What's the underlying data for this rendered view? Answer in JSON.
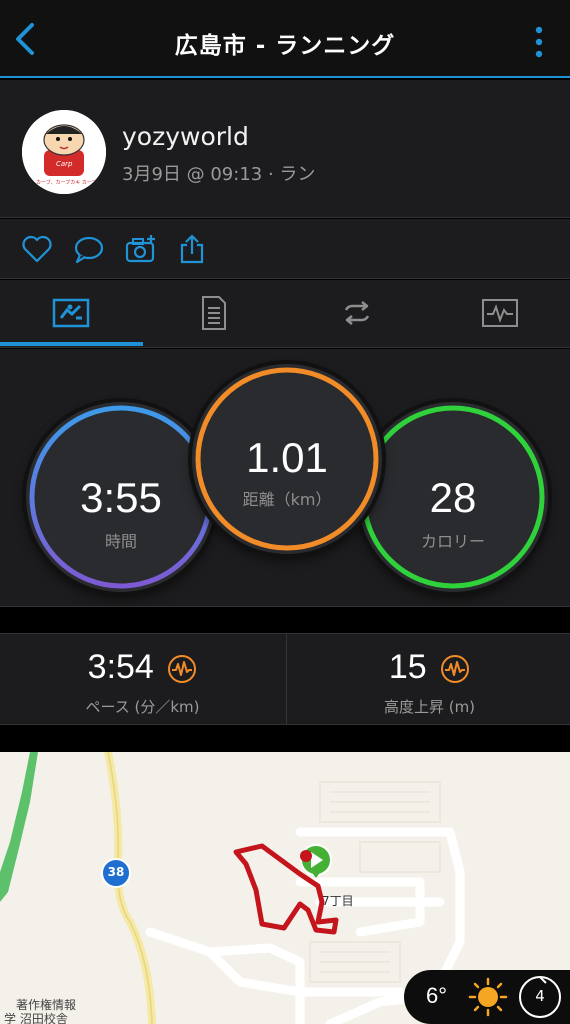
{
  "header": {
    "title": "広島市 - ランニング"
  },
  "profile": {
    "username": "yozyworld",
    "subline": "3月9日 @ 09:13 · ラン",
    "avatar_caption": "カーブ、カーブカキ カーブ!"
  },
  "tabs": [
    "overview",
    "details",
    "laps",
    "charts"
  ],
  "summary": {
    "time": {
      "value": "3:55",
      "label": "時間"
    },
    "distance": {
      "value": "1.01",
      "label": "距離（km）"
    },
    "calories": {
      "value": "28",
      "label": "カロリー"
    }
  },
  "stats": {
    "pace": {
      "value": "3:54",
      "label": "ペース (分／km)"
    },
    "elevation": {
      "value": "15",
      "label": "高度上昇 (m)"
    }
  },
  "map": {
    "route_badge": "38",
    "area_label": "7丁目",
    "poi_label": "著作権情報",
    "school_label": "学 沼田校舎"
  },
  "weather": {
    "temperature": "6°",
    "wind": "4"
  },
  "colors": {
    "accent": "#1f93d6",
    "time_ring_top": "#3d9be9",
    "time_ring_bottom": "#7d5ad3",
    "distance_ring": "#f28c28",
    "calories_ring": "#2fd23a",
    "route": "#c4141c",
    "start_pin": "#45b035"
  }
}
